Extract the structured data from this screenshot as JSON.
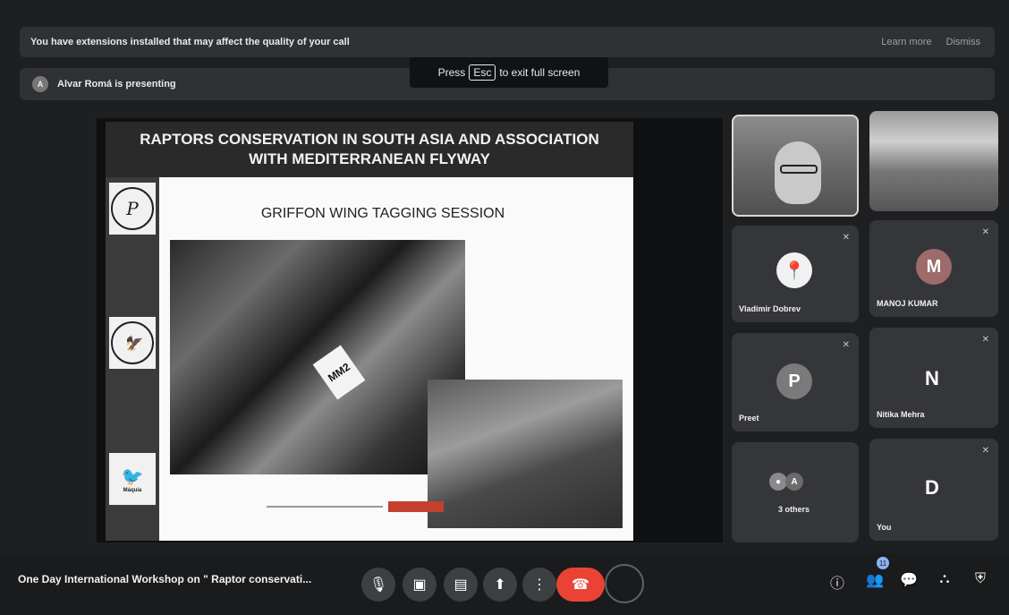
{
  "banner": {
    "message": "You have extensions installed that may affect the quality of your call",
    "learn_more": "Learn more",
    "dismiss": "Dismiss"
  },
  "presenting": {
    "avatar_initial": "A",
    "text": "Alvar Romá is presenting"
  },
  "fullscreen_tip": {
    "prefix": "Press",
    "key": "Esc",
    "suffix": "to exit full screen"
  },
  "slide": {
    "title_line1": "RAPTORS CONSERVATION IN SOUTH ASIA AND ASSOCIATION",
    "title_line2": "WITH MEDITERRANEAN FLYWAY",
    "subtitle": "GRIFFON WING TAGGING SESSION",
    "tag_text": "MM2",
    "logo1_letter": "P",
    "logo3_caption": "Máquia"
  },
  "participants": [
    {
      "name": "Vladimir Dobrev",
      "avatar": "pin-icon",
      "color": "#ffffff"
    },
    {
      "name": "MANOJ KUMAR",
      "avatar": "M",
      "color": "#9e6b6b"
    },
    {
      "name": "Preet",
      "avatar": "P",
      "color": "#7a7a7a"
    },
    {
      "name": "Nitika Mehra",
      "avatar": "N",
      "color": ""
    },
    {
      "name": "3 others",
      "avatar": "A",
      "color": "#6b6b6b"
    },
    {
      "name": "You",
      "avatar": "D",
      "color": ""
    }
  ],
  "bottom": {
    "meeting_title": "One Day International Workshop on \" Raptor conservati...",
    "people_count": "11"
  },
  "icons": {
    "mic": "mic-off-icon",
    "camera": "camera-off-icon",
    "captions": "captions-icon",
    "present": "present-icon",
    "more": "more-vert-icon",
    "hangup": "hangup-icon",
    "info": "info-icon",
    "people": "people-icon",
    "chat": "chat-icon",
    "activities": "activities-icon",
    "host": "host-controls-icon"
  }
}
